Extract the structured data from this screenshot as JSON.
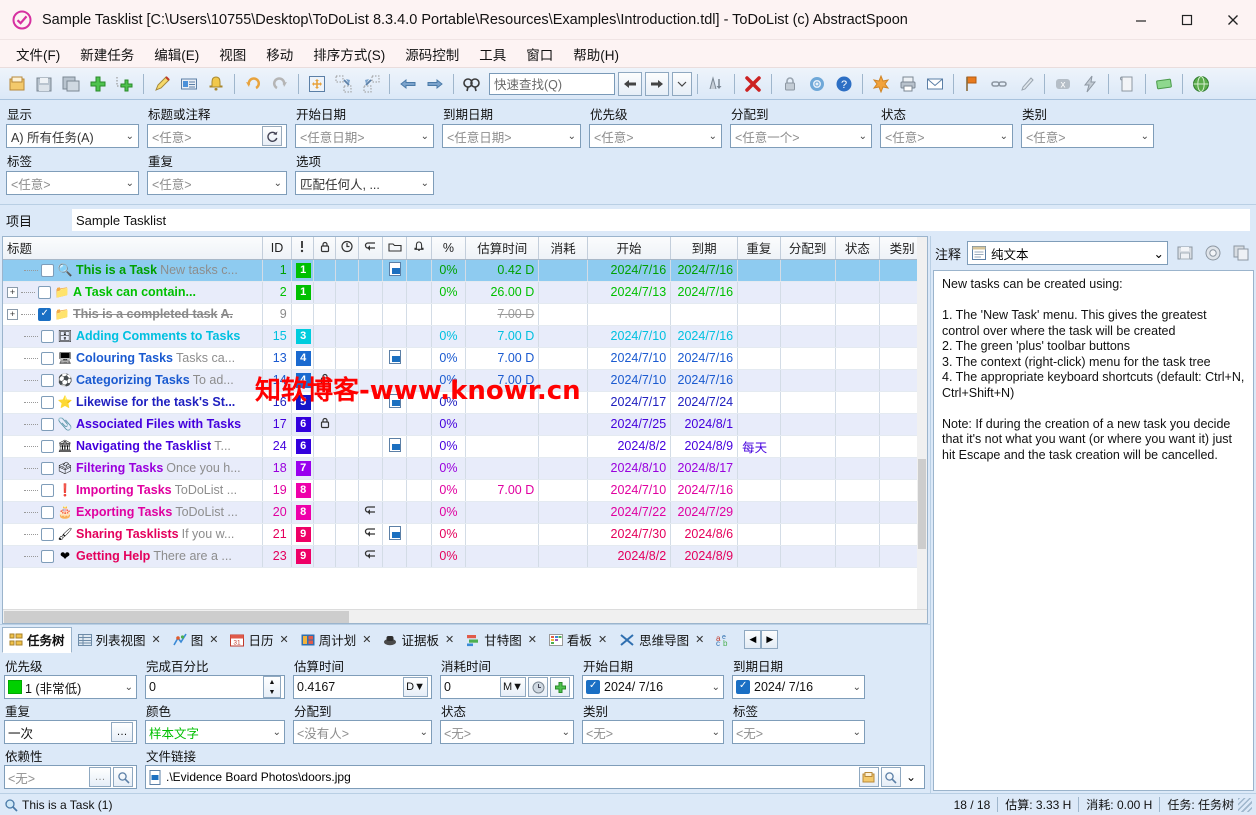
{
  "window": {
    "title": "Sample Tasklist [C:\\Users\\10755\\Desktop\\ToDoList 8.3.4.0 Portable\\Resources\\Examples\\Introduction.tdl] - ToDoList (c) AbstractSpoon",
    "app_icon": "checkmark-circle-icon",
    "minimize": "—",
    "maximize": "□",
    "close": "✕"
  },
  "menu": {
    "items": [
      {
        "label": "文件(F)",
        "name": "menu-file"
      },
      {
        "label": "新建任务",
        "name": "menu-new-task"
      },
      {
        "label": "编辑(E)",
        "name": "menu-edit"
      },
      {
        "label": "视图",
        "name": "menu-view"
      },
      {
        "label": "移动",
        "name": "menu-move"
      },
      {
        "label": "排序方式(S)",
        "name": "menu-sort"
      },
      {
        "label": "源码控制",
        "name": "menu-source-control"
      },
      {
        "label": "工具",
        "name": "menu-tools"
      },
      {
        "label": "窗口",
        "name": "menu-window"
      },
      {
        "label": "帮助(H)",
        "name": "menu-help"
      }
    ]
  },
  "toolbar": {
    "quick_find_placeholder": "快速查找(Q)",
    "quick_find_value": "",
    "icons": [
      "open-folder-icon",
      "save-icon",
      "save-all-icon",
      "add-task-icon",
      "add-subtask-icon",
      "edit-task-icon",
      "task-properties-icon",
      "reminder-bell-icon",
      "undo-icon",
      "redo-icon",
      "move-task-icon",
      "indent-task-icon",
      "outdent-task-icon",
      "back-arrow-icon",
      "forward-arrow-icon",
      "find-tasks-icon"
    ],
    "right_icons": [
      "sort-icon",
      "delete-task-icon",
      "lock-icon",
      "preferences-gear-icon",
      "help-icon",
      "spellcheck-icon",
      "print-icon",
      "email-icon",
      "flag-icon",
      "link-icon",
      "paint-icon",
      "clear-icon",
      "flash-icon",
      "log-icon",
      "money-icon",
      "web-icon"
    ]
  },
  "filters": {
    "row1": [
      {
        "label": "显示",
        "value": "A) 所有任务(A)",
        "placeholder": false,
        "name": "filter-show"
      },
      {
        "label": "标题或注释",
        "value": "<任意>",
        "placeholder": true,
        "name": "filter-title-or-comments"
      },
      {
        "label": "开始日期",
        "value": "<任意日期>",
        "placeholder": true,
        "name": "filter-start-date"
      },
      {
        "label": "到期日期",
        "value": "<任意日期>",
        "placeholder": true,
        "name": "filter-due-date"
      },
      {
        "label": "优先级",
        "value": "<任意>",
        "placeholder": true,
        "name": "filter-priority"
      },
      {
        "label": "分配到",
        "value": "<任意一个>",
        "placeholder": true,
        "name": "filter-allocated-to"
      },
      {
        "label": "状态",
        "value": "<任意>",
        "placeholder": true,
        "name": "filter-status"
      },
      {
        "label": "类别",
        "value": "<任意>",
        "placeholder": true,
        "name": "filter-category"
      }
    ],
    "row2": [
      {
        "label": "标签",
        "value": "<任意>",
        "placeholder": true,
        "name": "filter-tags"
      },
      {
        "label": "重复",
        "value": "<任意>",
        "placeholder": true,
        "name": "filter-recurrence"
      },
      {
        "label": "选项",
        "value": "匹配任何人, ...",
        "placeholder": false,
        "name": "filter-options"
      }
    ]
  },
  "project": {
    "label": "项目",
    "value": "Sample Tasklist"
  },
  "grid": {
    "columns": [
      {
        "label": "标题",
        "name": "col-title"
      },
      {
        "label": "ID",
        "name": "col-id"
      },
      {
        "label": "!",
        "name": "col-priority"
      },
      {
        "label": "lock-icon",
        "name": "col-lock"
      },
      {
        "label": "clock-icon",
        "name": "col-time"
      },
      {
        "label": "recurrence-icon",
        "name": "col-recurrence"
      },
      {
        "label": "file-icon",
        "name": "col-filelink"
      },
      {
        "label": "bell-icon",
        "name": "col-reminder"
      },
      {
        "label": "%",
        "name": "col-percent"
      },
      {
        "label": "估算时间",
        "name": "col-time-estimate"
      },
      {
        "label": "消耗",
        "name": "col-time-spent"
      },
      {
        "label": "开始",
        "name": "col-start"
      },
      {
        "label": "到期",
        "name": "col-due"
      },
      {
        "label": "重复",
        "name": "col-recur-text"
      },
      {
        "label": "分配到",
        "name": "col-allocated-to"
      },
      {
        "label": "状态",
        "name": "col-status"
      },
      {
        "label": "类别",
        "name": "col-category"
      }
    ],
    "rows": [
      {
        "indent": 1,
        "expander": "none",
        "checked": false,
        "icon": "🔍",
        "title": "This is a Task",
        "note": "New tasks c...",
        "id": "1",
        "prio": "1",
        "prio_color": "#00c000",
        "lock": false,
        "filelink": true,
        "recur": false,
        "pct": "0%",
        "est": "0.42 D",
        "spent": "",
        "start": "2024/7/16",
        "due": "2024/7/16",
        "recur_text": "",
        "alloc": "",
        "status": "",
        "cat": "",
        "color": "#00a000",
        "selected": true,
        "done": false
      },
      {
        "indent": 0,
        "expander": "plus",
        "checked": false,
        "icon": "📁",
        "title": "A Task can contain...",
        "note": "",
        "id": "2",
        "prio": "1",
        "prio_color": "#00c000",
        "lock": false,
        "filelink": false,
        "recur": false,
        "pct": "0%",
        "est": "26.00 D",
        "spent": "",
        "start": "2024/7/13",
        "due": "2024/7/16",
        "recur_text": "",
        "alloc": "",
        "status": "",
        "cat": "",
        "color": "#00c000",
        "selected": false,
        "done": false
      },
      {
        "indent": 0,
        "expander": "plus",
        "checked": true,
        "icon": "📁",
        "title": "This is a completed task",
        "note": "A.",
        "id": "9",
        "prio": "",
        "prio_color": "",
        "lock": false,
        "filelink": false,
        "recur": false,
        "pct": "",
        "est": "7.00 D",
        "spent": "",
        "start": "",
        "due": "",
        "recur_text": "",
        "alloc": "",
        "status": "",
        "cat": "",
        "color": "#8a8a8a",
        "selected": false,
        "done": true
      },
      {
        "indent": 1,
        "expander": "none",
        "checked": false,
        "icon": "🗄",
        "title": "Adding Comments to Tasks",
        "note": "",
        "id": "15",
        "prio": "3",
        "prio_color": "#00ccdd",
        "lock": false,
        "filelink": false,
        "recur": false,
        "pct": "0%",
        "est": "7.00 D",
        "spent": "",
        "start": "2024/7/10",
        "due": "2024/7/16",
        "recur_text": "",
        "alloc": "",
        "status": "",
        "cat": "",
        "color": "#00c0e0",
        "selected": false,
        "done": false
      },
      {
        "indent": 1,
        "expander": "none",
        "checked": false,
        "icon": "🖥",
        "title": "Colouring Tasks",
        "note": "Tasks ca...",
        "id": "13",
        "prio": "4",
        "prio_color": "#1a6ad0",
        "lock": false,
        "filelink": true,
        "recur": false,
        "pct": "0%",
        "est": "7.00 D",
        "spent": "",
        "start": "2024/7/10",
        "due": "2024/7/16",
        "recur_text": "",
        "alloc": "",
        "status": "",
        "cat": "",
        "color": "#1a5ad0",
        "selected": false,
        "done": false
      },
      {
        "indent": 1,
        "expander": "none",
        "checked": false,
        "icon": "⚽",
        "title": "Categorizing Tasks",
        "note": "To ad...",
        "id": "14",
        "prio": "4",
        "prio_color": "#1a6ad0",
        "lock": true,
        "filelink": false,
        "recur": false,
        "pct": "0%",
        "est": "7.00 D",
        "spent": "",
        "start": "2024/7/10",
        "due": "2024/7/16",
        "recur_text": "",
        "alloc": "",
        "status": "",
        "cat": "",
        "color": "#1a5ad0",
        "selected": false,
        "done": false
      },
      {
        "indent": 1,
        "expander": "none",
        "checked": false,
        "icon": "⭐",
        "title": "Likewise for the task's St...",
        "note": "",
        "id": "16",
        "prio": "5",
        "prio_color": "#1414c8",
        "lock": false,
        "filelink": true,
        "recur": false,
        "pct": "0%",
        "est": "",
        "spent": "",
        "start": "2024/7/17",
        "due": "2024/7/24",
        "recur_text": "",
        "alloc": "",
        "status": "",
        "cat": "",
        "color": "#2020c0",
        "selected": false,
        "done": false
      },
      {
        "indent": 1,
        "expander": "none",
        "checked": false,
        "icon": "📎",
        "title": "Associated Files with Tasks",
        "note": "",
        "id": "17",
        "prio": "6",
        "prio_color": "#3300dd",
        "lock": true,
        "filelink": false,
        "recur": false,
        "pct": "0%",
        "est": "",
        "spent": "",
        "start": "2024/7/25",
        "due": "2024/8/1",
        "recur_text": "",
        "alloc": "",
        "status": "",
        "cat": "",
        "color": "#4400dd",
        "selected": false,
        "done": false
      },
      {
        "indent": 1,
        "expander": "none",
        "checked": false,
        "icon": "🏛",
        "title": "Navigating the Tasklist",
        "note": "T...",
        "id": "24",
        "prio": "6",
        "prio_color": "#3300dd",
        "lock": false,
        "filelink": true,
        "recur": false,
        "pct": "0%",
        "est": "",
        "spent": "",
        "start": "2024/8/2",
        "due": "2024/8/9",
        "recur_text": "每天",
        "alloc": "",
        "status": "",
        "cat": "",
        "color": "#4400dd",
        "selected": false,
        "done": false
      },
      {
        "indent": 1,
        "expander": "none",
        "checked": false,
        "icon": "🗳",
        "title": "Filtering Tasks",
        "note": "Once you h...",
        "id": "18",
        "prio": "7",
        "prio_color": "#9900ee",
        "lock": false,
        "filelink": false,
        "recur": false,
        "pct": "0%",
        "est": "",
        "spent": "",
        "start": "2024/8/10",
        "due": "2024/8/17",
        "recur_text": "",
        "alloc": "",
        "status": "",
        "cat": "",
        "color": "#9900dd",
        "selected": false,
        "done": false
      },
      {
        "indent": 1,
        "expander": "none",
        "checked": false,
        "icon": "❗",
        "title": "Importing Tasks",
        "note": "ToDoList ...",
        "id": "19",
        "prio": "8",
        "prio_color": "#ee00aa",
        "lock": false,
        "filelink": false,
        "recur": false,
        "pct": "0%",
        "est": "7.00 D",
        "spent": "",
        "start": "2024/7/10",
        "due": "2024/7/16",
        "recur_text": "",
        "alloc": "",
        "status": "",
        "cat": "",
        "color": "#e000a0",
        "selected": false,
        "done": false
      },
      {
        "indent": 1,
        "expander": "none",
        "checked": false,
        "icon": "🎂",
        "title": "Exporting Tasks",
        "note": "ToDoList ...",
        "id": "20",
        "prio": "8",
        "prio_color": "#ee00aa",
        "lock": false,
        "filelink": false,
        "recur": true,
        "pct": "0%",
        "est": "",
        "spent": "",
        "start": "2024/7/22",
        "due": "2024/7/29",
        "recur_text": "",
        "alloc": "",
        "status": "",
        "cat": "",
        "color": "#e000a0",
        "selected": false,
        "done": false
      },
      {
        "indent": 1,
        "expander": "none",
        "checked": false,
        "icon": "🖌",
        "title": "Sharing Tasklists",
        "note": "If you w...",
        "id": "21",
        "prio": "9",
        "prio_color": "#ee0066",
        "lock": false,
        "filelink": true,
        "recur": true,
        "pct": "0%",
        "est": "",
        "spent": "",
        "start": "2024/7/30",
        "due": "2024/8/6",
        "recur_text": "",
        "alloc": "",
        "status": "",
        "cat": "",
        "color": "#e4005c",
        "selected": false,
        "done": false
      },
      {
        "indent": 1,
        "expander": "none",
        "checked": false,
        "icon": "❤",
        "title": "Getting Help",
        "note": "There are a ...",
        "id": "23",
        "prio": "9",
        "prio_color": "#ee0066",
        "lock": false,
        "filelink": false,
        "recur": true,
        "pct": "0%",
        "est": "",
        "spent": "",
        "start": "2024/8/2",
        "due": "2024/8/9",
        "recur_text": "",
        "alloc": "",
        "status": "",
        "cat": "",
        "color": "#e4005c",
        "selected": false,
        "done": false
      }
    ]
  },
  "comments": {
    "label": "注释",
    "format": "纯文本",
    "format_icon": "notepad-icon",
    "buttons": [
      "save-comment-icon",
      "clock-comment-icon",
      "copy-comment-icon"
    ],
    "text": "New tasks can be created using:\n\n1. The 'New Task' menu. This gives the greatest control over where the task will be created\n2. The green 'plus' toolbar buttons\n3. The context (right-click) menu for the task tree\n4. The appropriate keyboard shortcuts (default: Ctrl+N, Ctrl+Shift+N)\n\nNote: If during the creation of a new task you decide that it's not what you want (or where you want it) just hit Escape and the task creation will be cancelled."
  },
  "tabs": {
    "items": [
      {
        "label": "任务树",
        "icon": "task-tree-icon",
        "active": true,
        "closable": false,
        "name": "tab-task-tree"
      },
      {
        "label": "列表视图",
        "icon": "list-view-icon",
        "active": false,
        "closable": true,
        "name": "tab-list-view"
      },
      {
        "label": "图",
        "icon": "chart-icon",
        "active": false,
        "closable": true,
        "name": "tab-chart"
      },
      {
        "label": "日历",
        "icon": "calendar-icon",
        "active": false,
        "closable": true,
        "name": "tab-calendar"
      },
      {
        "label": "周计划",
        "icon": "week-planner-icon",
        "active": false,
        "closable": true,
        "name": "tab-week-planner"
      },
      {
        "label": "证据板",
        "icon": "evidence-board-icon",
        "active": false,
        "closable": true,
        "name": "tab-evidence-board"
      },
      {
        "label": "甘特图",
        "icon": "gantt-icon",
        "active": false,
        "closable": true,
        "name": "tab-gantt"
      },
      {
        "label": "看板",
        "icon": "kanban-icon",
        "active": false,
        "closable": true,
        "name": "tab-kanban"
      },
      {
        "label": "思维导图",
        "icon": "mindmap-icon",
        "active": false,
        "closable": true,
        "name": "tab-mindmap"
      }
    ],
    "extra_icon": "abc-icon",
    "nav_left": "◀",
    "nav_right": "▶"
  },
  "properties": {
    "priority": {
      "label": "优先级",
      "value": "1 (非常低)",
      "color": "#00d000"
    },
    "percent_done": {
      "label": "完成百分比",
      "value": "0"
    },
    "time_estimate": {
      "label": "估算时间",
      "value": "0.4167",
      "unit": "D"
    },
    "time_spent": {
      "label": "消耗时间",
      "value": "0",
      "unit": "M"
    },
    "start_date": {
      "label": "开始日期",
      "value": "2024/  7/16",
      "checked": true
    },
    "due_date": {
      "label": "到期日期",
      "value": "2024/  7/16",
      "checked": true
    },
    "recurrence": {
      "label": "重复",
      "value": "一次"
    },
    "color": {
      "label": "颜色",
      "value": "样本文字",
      "text_color": "#00c000"
    },
    "allocated_to": {
      "label": "分配到",
      "value": "<没有人>"
    },
    "status": {
      "label": "状态",
      "value": "<无>"
    },
    "category": {
      "label": "类别",
      "value": "<无>"
    },
    "tags": {
      "label": "标签",
      "value": "<无>"
    },
    "dependency": {
      "label": "依赖性",
      "value": "<无>"
    },
    "file_link": {
      "label": "文件链接",
      "value": ".\\Evidence Board Photos\\doors.jpg"
    }
  },
  "statusbar": {
    "task_icon": "🔍",
    "task_label": "This is a Task  (1)",
    "count": "18 / 18",
    "estimate": "估算: 3.33 H",
    "spent": "消耗: 0.00 H",
    "view": "任务: 任务树"
  },
  "watermark": "知软博客-www.knowr.cn"
}
